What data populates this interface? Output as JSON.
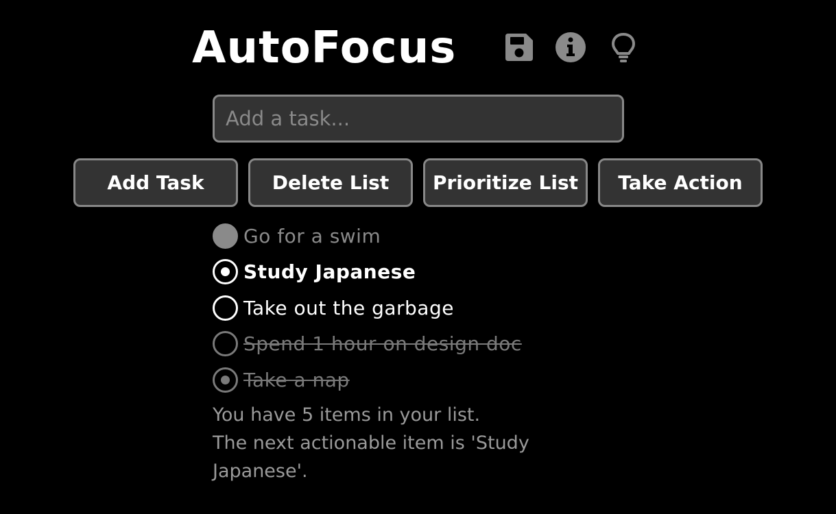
{
  "app": {
    "title": "AutoFocus",
    "icons": [
      "save-icon",
      "info-icon",
      "lightbulb-icon"
    ]
  },
  "input": {
    "placeholder": "Add a task...",
    "value": ""
  },
  "buttons": {
    "add_task": "Add Task",
    "delete_list": "Delete List",
    "prioritize_list": "Prioritize List",
    "take_action": "Take Action"
  },
  "tasks": [
    {
      "label": "Go for a swim",
      "state": "completed"
    },
    {
      "label": "Study Japanese",
      "state": "next-actionable"
    },
    {
      "label": "Take out the garbage",
      "state": "open"
    },
    {
      "label": "Spend 1 hour on design doc",
      "state": "struck"
    },
    {
      "label": "Take a nap",
      "state": "struck-dotted"
    }
  ],
  "status": {
    "count_line": "You have 5 items in your list.",
    "next_line": "The next actionable item is 'Study Japanese'."
  },
  "colors": {
    "background": "#000000",
    "surface": "#333333",
    "border": "#888888",
    "text": "#ffffff",
    "muted": "#8a8a8a"
  }
}
